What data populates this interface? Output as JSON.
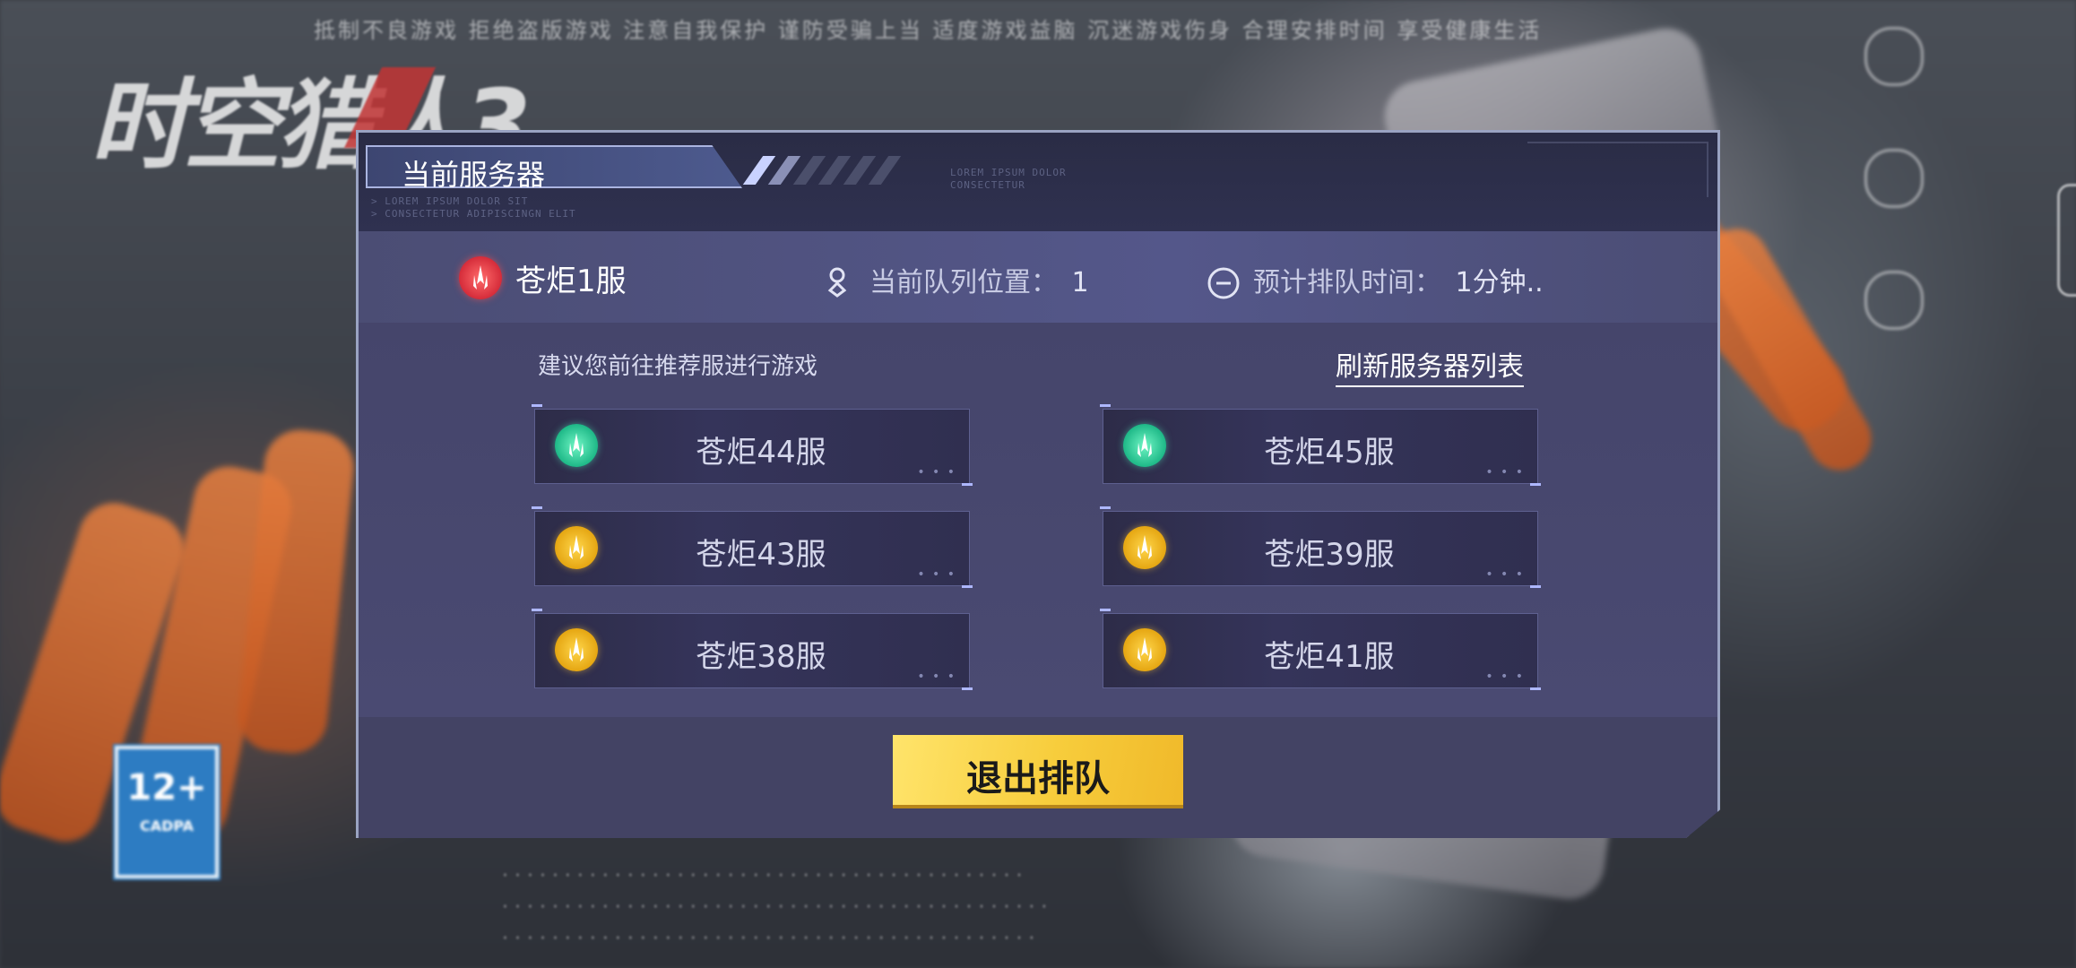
{
  "background": {
    "logo_text": "时空猎人3",
    "top_line": "抵制不良游戏  拒绝盗版游戏  注意自我保护  谨防受骗上当  适度游戏益脑  沉迷游戏伤身  合理安排时间  享受健康生活",
    "rating_label": "12+",
    "rating_sub": "CADPA"
  },
  "dialog": {
    "title": "当前服务器",
    "lorem_right": "LOREM IPSUM DOLOR\nCONSECTETUR",
    "lorem_left": "> LOREM IPSUM DOLOR SIT\n> CONSECTETUR ADIPISCINGN ELIT",
    "current_server": {
      "name": "苍炬1服",
      "icon": "server-red-icon",
      "color": "#d52c3a"
    },
    "queue_position_label": "当前队列位置：",
    "queue_position_value": "1",
    "eta_label": "预计排队时间：",
    "eta_value": "1分钟..",
    "recommend_text": "建议您前往推荐服进行游戏",
    "refresh_label": "刷新服务器列表",
    "servers": [
      {
        "name": "苍炬44服",
        "status": "green",
        "color": "#1eb887"
      },
      {
        "name": "苍炬45服",
        "status": "green",
        "color": "#1eb887"
      },
      {
        "name": "苍炬43服",
        "status": "yellow",
        "color": "#e5a612"
      },
      {
        "name": "苍炬39服",
        "status": "yellow",
        "color": "#e5a612"
      },
      {
        "name": "苍炬38服",
        "status": "yellow",
        "color": "#e5a612"
      },
      {
        "name": "苍炬41服",
        "status": "yellow",
        "color": "#e5a612"
      }
    ],
    "quit_label": "退出排队"
  }
}
